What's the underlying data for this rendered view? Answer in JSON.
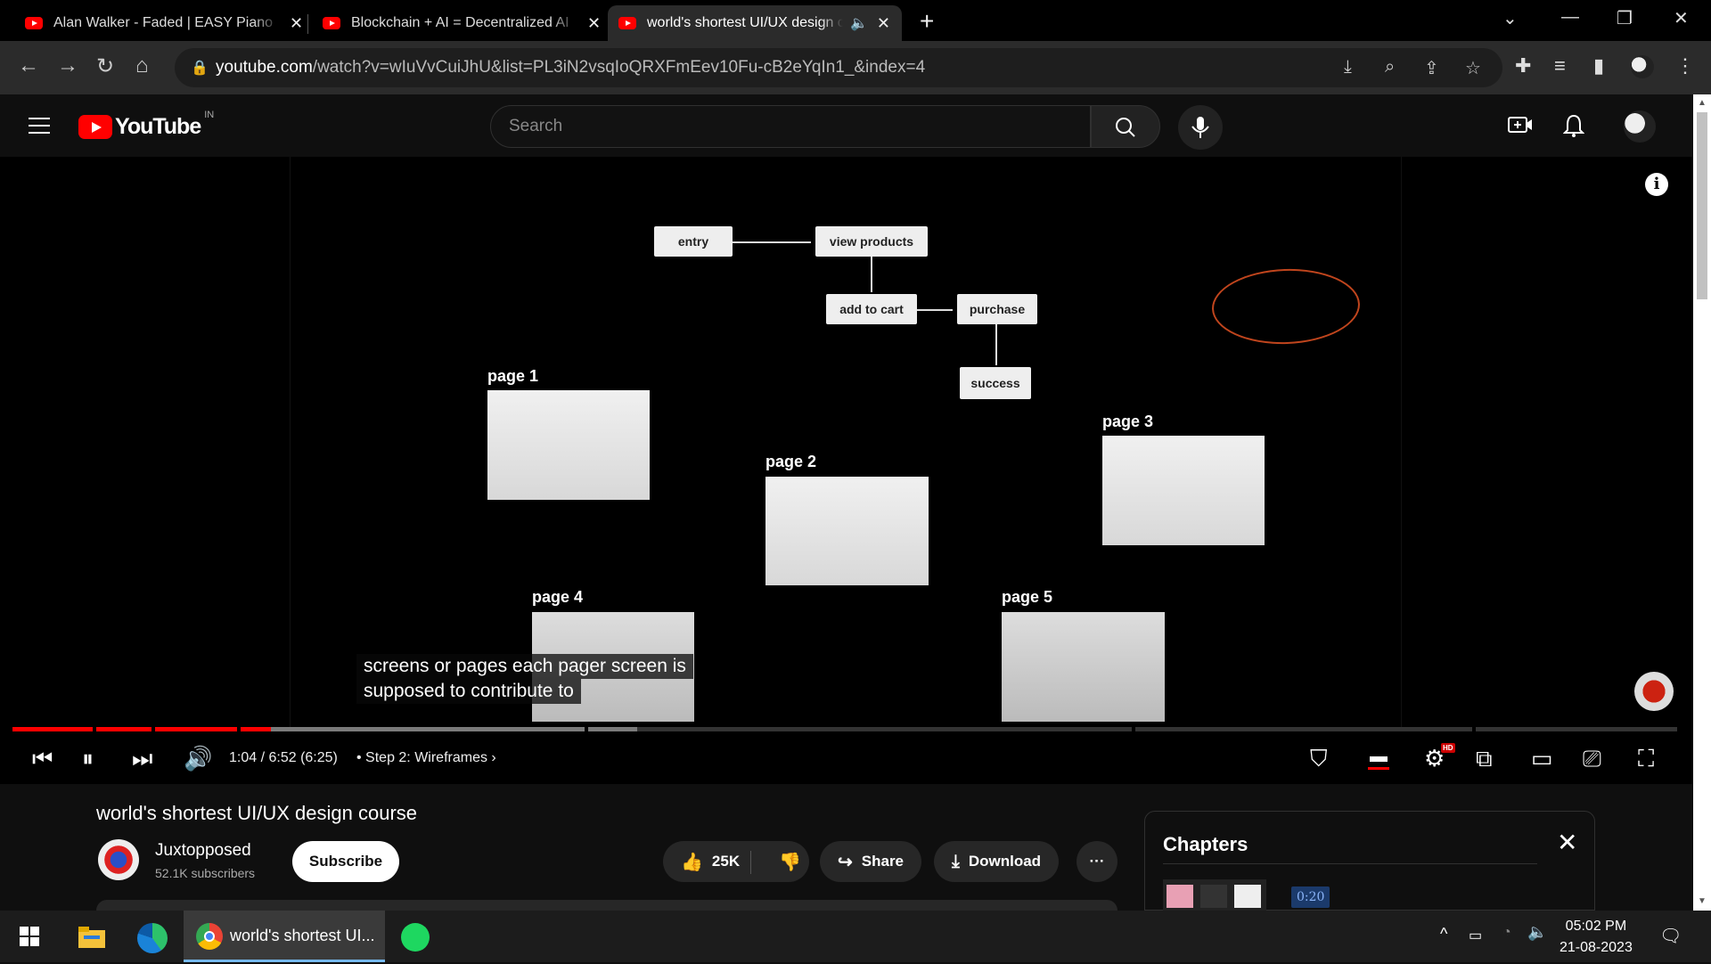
{
  "browser": {
    "tabs": [
      {
        "title": "Alan Walker - Faded | EASY Piano",
        "active": false
      },
      {
        "title": "Blockchain + AI = Decentralized AI",
        "active": false
      },
      {
        "title": "world's shortest UI/UX design course",
        "active": true
      }
    ],
    "url_host": "youtube.com",
    "url_path": "/watch?v=wIuVvCuiJhU&list=PL3iN2vsqIoQRXFmEev10Fu-cB2eYqIn1_&index=4"
  },
  "youtube": {
    "logo_text": "YouTube",
    "country_code": "IN",
    "search_placeholder": "Search"
  },
  "video": {
    "diagram": {
      "nodes": {
        "entry": "entry",
        "view_products": "view products",
        "add_to_cart": "add to cart",
        "purchase": "purchase",
        "success": "success"
      }
    },
    "pages": [
      "page 1",
      "page 2",
      "page 3",
      "page 4",
      "page 5"
    ],
    "captions": [
      "screens or pages each pager screen is",
      "supposed to contribute to"
    ],
    "time_current": "1:04",
    "time_total": "6:52",
    "time_adjusted": "(6:25)",
    "chapter_label": "Step 2: Wireframes",
    "progress_fraction": 0.155,
    "buffer_fraction": 0.375,
    "hd_badge": "HD"
  },
  "meta": {
    "title": "world's shortest UI/UX design course",
    "channel": "Juxtopposed",
    "subscribers": "52.1K subscribers",
    "subscribe_label": "Subscribe",
    "likes": "25K",
    "share_label": "Share",
    "download_label": "Download"
  },
  "chapters_panel": {
    "title": "Chapters",
    "first_time": "0:20"
  },
  "taskbar": {
    "chrome_label": "world's shortest UI...",
    "time": "05:02 PM",
    "date": "21-08-2023"
  }
}
